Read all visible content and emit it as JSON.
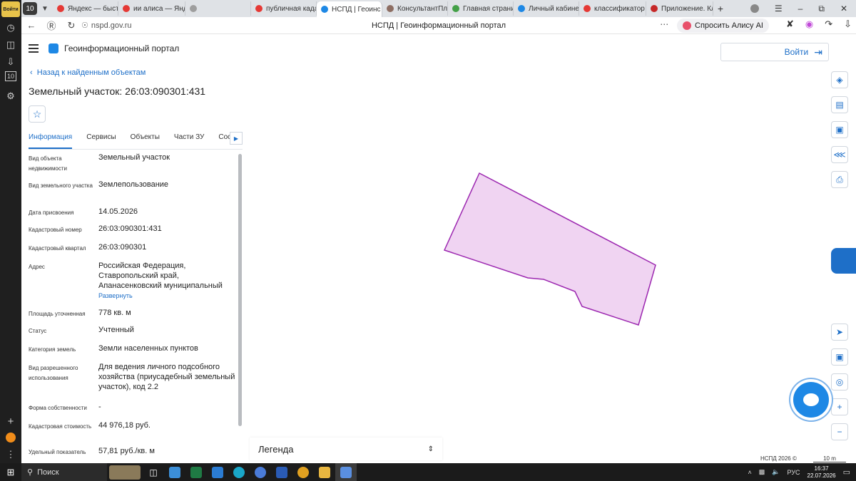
{
  "browser": {
    "sidebar_badge": "Войти",
    "sidebar_counter": "10",
    "tab_counter": "10",
    "tabs": [
      {
        "label": "Яндекс — быстр",
        "color": "#e53935"
      },
      {
        "label": "ии алиса — Янде",
        "color": "#e53935"
      },
      {
        "label": "",
        "color": "#9e9e9e"
      },
      {
        "label": "публичная кадас",
        "color": "#e53935"
      },
      {
        "label": "НСПД | Геоинс",
        "color": "#1e88e5",
        "active": true
      },
      {
        "label": "КонсультантПлю",
        "color": "#8d6e63"
      },
      {
        "label": "Главная страниц",
        "color": "#43a047"
      },
      {
        "label": "Личный кабинет",
        "color": "#1e88e5"
      },
      {
        "label": "классификатор в",
        "color": "#e53935"
      },
      {
        "label": "Приложение. Кла",
        "color": "#c62828"
      }
    ],
    "url": "nspd.gov.ru",
    "page_title": "НСПД | Геоинформационный портал",
    "alice_label": "Спросить Алису AI"
  },
  "app": {
    "name": "Геоинформационный портал",
    "back_link": "Назад к найденным объектам",
    "object_title": "Земельный участок: 26:03:090301:431",
    "tabs": [
      "Информация",
      "Сервисы",
      "Объекты",
      "Части ЗУ",
      "Состав"
    ],
    "properties": [
      {
        "label": "Вид объекта недвижимости",
        "value": "Земельный участок"
      },
      {
        "label": "Вид земельного участка",
        "value": "Землепользование"
      },
      {
        "label": "Дата присвоения",
        "value": "14.05.2026"
      },
      {
        "label": "Кадастровый номер",
        "value": "26:03:090301:431"
      },
      {
        "label": "Кадастровый квартал",
        "value": "26:03:090301"
      },
      {
        "label": "Адрес",
        "value": "Российская Федерация, Ставропольский край, Апанасенковский муниципальный",
        "expand": "Развернуть"
      },
      {
        "label": "Площадь уточненная",
        "value": "778 кв. м"
      },
      {
        "label": "Статус",
        "value": "Учтенный"
      },
      {
        "label": "Категория земель",
        "value": "Земли населенных пунктов"
      },
      {
        "label": "Вид разрешенного использования",
        "value": "Для ведения личного подсобного хозяйства (приусадебный земельный участок), код 2.2"
      },
      {
        "label": "Форма собственности",
        "value": "-"
      },
      {
        "label": "Кадастровая стоимость",
        "value": "44 976,18 руб."
      },
      {
        "label": "Удельный показатель",
        "value": "57,81 руб./кв. м"
      }
    ]
  },
  "map": {
    "login_label": "Войти",
    "legend_label": "Легенда",
    "copyright": "НСПД 2026 ©",
    "scale_label": "10 m",
    "parcel_fill": "#f0d4f2",
    "parcel_stroke": "#9c27b0"
  },
  "taskbar": {
    "search_label": "Поиск",
    "lang": "РУС",
    "time": "16:37",
    "date": "22.07.2026"
  }
}
